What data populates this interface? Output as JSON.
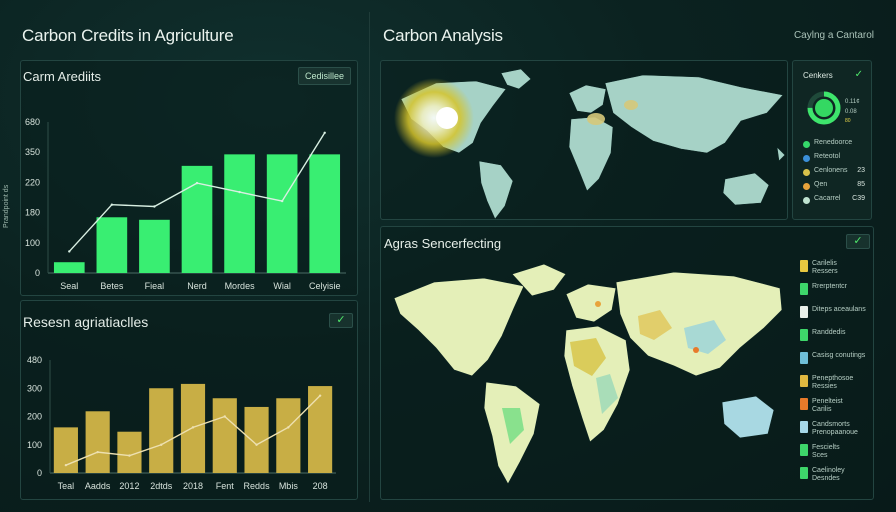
{
  "header": {
    "left_title": "Carbon Credits in Agriculture",
    "right_title": "Carbon Analysis",
    "right_action": "Caylng a Cantarol"
  },
  "panel1": {
    "title": "Carm Arediits",
    "badge": "Cedisillee",
    "y_axis_label": "Prandpoint ds",
    "chart_data": {
      "type": "bar",
      "categories": [
        "Seal",
        "Betes",
        "Fieal",
        "Nerd",
        "Mordes",
        "Wial",
        "Celyisie"
      ],
      "values": [
        30,
        155,
        148,
        298,
        330,
        330,
        330
      ],
      "line": [
        60,
        190,
        185,
        250,
        225,
        200,
        390
      ],
      "yticks": [
        "0",
        "100",
        "180",
        "220",
        "350",
        "680"
      ],
      "ylim": [
        0,
        420
      ]
    },
    "colors": {
      "bar": "#39ee72",
      "line": "#d8efe2"
    }
  },
  "panel2": {
    "title": "Resesn agriatiaclles",
    "chart_data": {
      "type": "bar",
      "categories": [
        "Teal",
        "Aadds",
        "2012",
        "2dtds",
        "2018",
        "Fent",
        "Redds",
        "Mbis",
        "208"
      ],
      "values": [
        105,
        142,
        95,
        195,
        205,
        172,
        152,
        172,
        200
      ],
      "line": [
        18,
        48,
        40,
        65,
        105,
        130,
        65,
        105,
        178
      ],
      "yticks": [
        "0",
        "100",
        "200",
        "300",
        "480"
      ],
      "ylim": [
        0,
        260
      ]
    },
    "colors": {
      "bar": "#c8ae45",
      "line": "#ede0b0"
    }
  },
  "map1": {
    "title": "Carbon Analysis",
    "legend": {
      "title": "Cenkers",
      "progress": 0.75,
      "progress_label": "0.11¢\n0.08",
      "percent_label": "80",
      "items": [
        {
          "label": "Renedoorce",
          "value": "",
          "color": "#35d86a"
        },
        {
          "label": "Reteotol",
          "value": "",
          "color": "#3b8fd8"
        },
        {
          "label": "Cenlonens",
          "value": "23",
          "color": "#d8c14a"
        },
        {
          "label": "Qen",
          "value": "85",
          "color": "#e8a33b"
        },
        {
          "label": "Cacarrel",
          "value": "C39",
          "color": "#bfe3d0"
        }
      ]
    }
  },
  "map2": {
    "title": "Agras Sencerfecting",
    "legend": {
      "items": [
        {
          "label": "Carilelis\nRessers",
          "color": "#e8c840"
        },
        {
          "label": "Rrerptentcr",
          "color": "#3ed66a"
        },
        {
          "label": "Diteps aceaulans",
          "color": "#e8f0ea"
        },
        {
          "label": "Randdedis",
          "color": "#3ed66a"
        },
        {
          "label": "Casisg conutings",
          "color": "#6fbfd8"
        },
        {
          "label": "Penepthosoe\nRessies",
          "color": "#e0b840"
        },
        {
          "label": "Penelteist\nCarilis",
          "color": "#e87a2a"
        },
        {
          "label": "Candsmorts\nPrenopaanoue",
          "color": "#a6d8e8"
        },
        {
          "label": "Fescielts\nSces",
          "color": "#3ed66a"
        },
        {
          "label": "Caelinoley\nDesndes",
          "color": "#3ed66a"
        }
      ]
    }
  }
}
